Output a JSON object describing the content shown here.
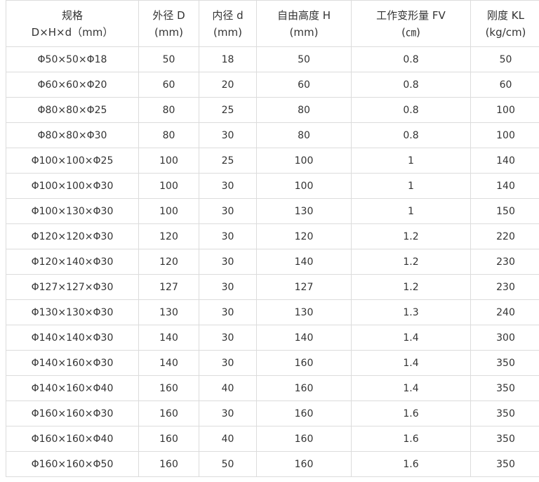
{
  "table": {
    "headers": [
      {
        "line1": "规格",
        "line2": "D×H×d（mm）"
      },
      {
        "line1": "外径 D",
        "line2": "(mm)"
      },
      {
        "line1": "内径 d",
        "line2": "(mm)"
      },
      {
        "line1": "自由高度 H",
        "line2": "(mm)"
      },
      {
        "line1": "工作变形量 FV",
        "line2": "(㎝)"
      },
      {
        "line1": "刚度 KL",
        "line2": "(kg/cm)"
      }
    ],
    "rows": [
      [
        "Φ50×50×Φ18",
        "50",
        "18",
        "50",
        "0.8",
        "50"
      ],
      [
        "Φ60×60×Φ20",
        "60",
        "20",
        "60",
        "0.8",
        "60"
      ],
      [
        "Φ80×80×Φ25",
        "80",
        "25",
        "80",
        "0.8",
        "100"
      ],
      [
        "Φ80×80×Φ30",
        "80",
        "30",
        "80",
        "0.8",
        "100"
      ],
      [
        "Φ100×100×Φ25",
        "100",
        "25",
        "100",
        "1",
        "140"
      ],
      [
        "Φ100×100×Φ30",
        "100",
        "30",
        "100",
        "1",
        "140"
      ],
      [
        "Φ100×130×Φ30",
        "100",
        "30",
        "130",
        "1",
        "150"
      ],
      [
        "Φ120×120×Φ30",
        "120",
        "30",
        "120",
        "1.2",
        "220"
      ],
      [
        "Φ120×140×Φ30",
        "120",
        "30",
        "140",
        "1.2",
        "230"
      ],
      [
        "Φ127×127×Φ30",
        "127",
        "30",
        "127",
        "1.2",
        "230"
      ],
      [
        "Φ130×130×Φ30",
        "130",
        "30",
        "130",
        "1.3",
        "240"
      ],
      [
        "Φ140×140×Φ30",
        "140",
        "30",
        "140",
        "1.4",
        "300"
      ],
      [
        "Φ140×160×Φ30",
        "140",
        "30",
        "160",
        "1.4",
        "350"
      ],
      [
        "Φ140×160×Φ40",
        "160",
        "40",
        "160",
        "1.4",
        "350"
      ],
      [
        "Φ160×160×Φ30",
        "160",
        "30",
        "160",
        "1.6",
        "350"
      ],
      [
        "Φ160×160×Φ40",
        "160",
        "40",
        "160",
        "1.6",
        "350"
      ],
      [
        "Φ160×160×Φ50",
        "160",
        "50",
        "160",
        "1.6",
        "350"
      ]
    ]
  }
}
